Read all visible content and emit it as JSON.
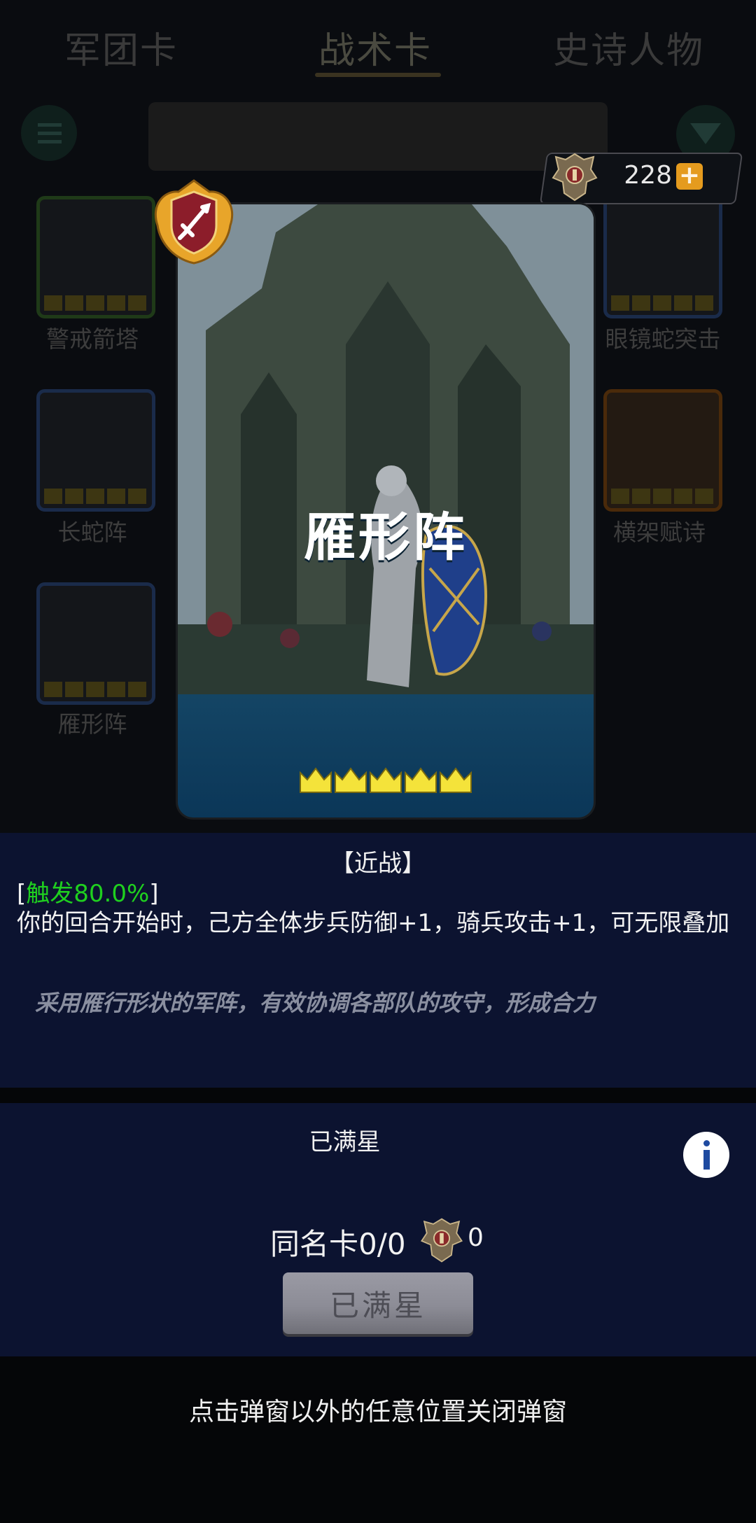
{
  "background": {
    "tabs": [
      "军团卡",
      "战术卡",
      "史诗人物"
    ],
    "cards": [
      {
        "label": "警戒箭塔"
      },
      {
        "label": "眼镜蛇突击"
      },
      {
        "label": "长蛇阵"
      },
      {
        "label": "横架赋诗"
      },
      {
        "label": "雁形阵"
      }
    ]
  },
  "currency": {
    "value": "228",
    "plus": "+"
  },
  "card": {
    "title": "雁形阵",
    "stars": 5,
    "badge_icon": "sword-badge-icon"
  },
  "description": {
    "type_tag": "【近战】",
    "trigger_open": "[",
    "trigger": "触发80.0%",
    "trigger_close": "]",
    "effect": "你的回合开始时，己方全体步兵防御+1，骑兵攻击+1，可无限叠加",
    "flavor": "采用雁行形状的军阵，有效协调各部队的攻守，形成合力"
  },
  "status": {
    "label": "已满星",
    "same_card_label": "同名卡0/0",
    "same_card_value": "0",
    "button": "已满星",
    "info_icon": "info-icon"
  },
  "hint": "点击弹窗以外的任意位置关闭弹窗",
  "colors": {
    "trigger": "#1fd01f",
    "panel": "#0c1330",
    "band": "#0e4a72",
    "plus": "#e59b1e"
  }
}
